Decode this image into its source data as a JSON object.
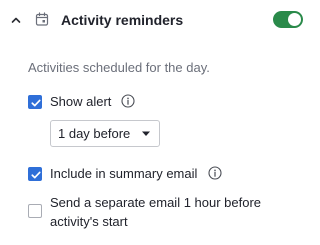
{
  "section": {
    "title": "Activity reminders",
    "expanded": true,
    "enabled": true,
    "description": "Activities scheduled for the day."
  },
  "options": {
    "show_alert": {
      "label": "Show alert",
      "checked": true
    },
    "alert_timing": {
      "selected": "1 day before"
    },
    "summary_email": {
      "label": "Include in summary email",
      "checked": true
    },
    "separate_email": {
      "label": "Send a separate email 1 hour before activity's start",
      "checked": false
    }
  },
  "colors": {
    "toggle_on": "#2a8a4a",
    "checkbox_checked": "#2f6fd8",
    "muted_text": "#6b6f7a"
  },
  "icons": {
    "collapse": "chevron-up-icon",
    "section": "calendar-icon",
    "info": "info-icon",
    "dropdown": "caret-down-icon",
    "check": "check-icon"
  }
}
